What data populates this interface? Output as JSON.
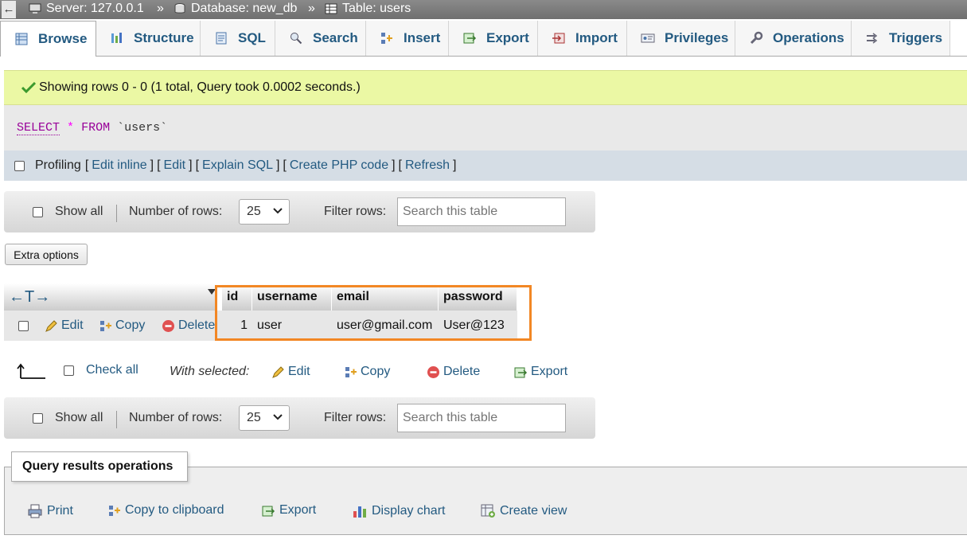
{
  "breadcrumb": {
    "back_icon": "left-arrow-icon",
    "server": "Server: 127.0.0.1",
    "database": "Database: new_db",
    "table": "Table: users",
    "separator": "»"
  },
  "tabs": [
    {
      "label": "Browse",
      "icon": "browse-icon",
      "active": true
    },
    {
      "label": "Structure",
      "icon": "structure-icon"
    },
    {
      "label": "SQL",
      "icon": "sql-icon"
    },
    {
      "label": "Search",
      "icon": "search-icon"
    },
    {
      "label": "Insert",
      "icon": "insert-icon"
    },
    {
      "label": "Export",
      "icon": "export-icon"
    },
    {
      "label": "Import",
      "icon": "import-icon"
    },
    {
      "label": "Privileges",
      "icon": "privileges-icon"
    },
    {
      "label": "Operations",
      "icon": "operations-icon"
    },
    {
      "label": "Triggers",
      "icon": "triggers-icon"
    }
  ],
  "success": {
    "message": "Showing rows 0 - 0 (1 total, Query took 0.0002 seconds.)"
  },
  "sql": {
    "select": "SELECT",
    "star": "*",
    "from": "FROM",
    "table": "`users`"
  },
  "profiling": {
    "label": "Profiling",
    "open": "[",
    "close": "]",
    "links": [
      "Edit inline",
      "Edit",
      "Explain SQL",
      "Create PHP code",
      "Refresh"
    ]
  },
  "nav": {
    "show_all": "Show all",
    "rows_label": "Number of rows:",
    "rows_value": "25",
    "filter_label": "Filter rows:",
    "filter_placeholder": "Search this table"
  },
  "extra_options": "Extra options",
  "table": {
    "resize_arrows": "←T→",
    "columns": [
      "id",
      "username",
      "email",
      "password"
    ],
    "rows": [
      {
        "id": "1",
        "username": "user",
        "email": "user@gmail.com",
        "password": "User@123"
      }
    ],
    "row_actions": {
      "edit": "Edit",
      "copy": "Copy",
      "delete": "Delete"
    }
  },
  "bulk": {
    "check_all": "Check all",
    "with_selected": "With selected:",
    "edit": "Edit",
    "copy": "Copy",
    "delete": "Delete",
    "export": "Export"
  },
  "operations": {
    "legend": "Query results operations",
    "items": [
      "Print",
      "Copy to clipboard",
      "Export",
      "Display chart",
      "Create view"
    ]
  },
  "colors": {
    "link": "#235a81",
    "success_bg": "#ebf8a4",
    "highlight_border": "#f28724"
  }
}
